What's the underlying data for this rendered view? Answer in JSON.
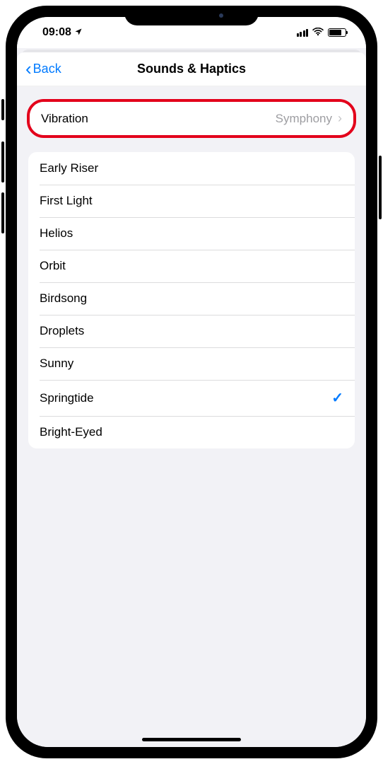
{
  "statusBar": {
    "time": "09:08",
    "locationIcon": "location-arrow"
  },
  "nav": {
    "backLabel": "Back",
    "title": "Sounds & Haptics"
  },
  "vibration": {
    "label": "Vibration",
    "value": "Symphony"
  },
  "highlighted": "vibration",
  "sounds": [
    {
      "label": "Early Riser",
      "selected": false
    },
    {
      "label": "First Light",
      "selected": false
    },
    {
      "label": "Helios",
      "selected": false
    },
    {
      "label": "Orbit",
      "selected": false
    },
    {
      "label": "Birdsong",
      "selected": false
    },
    {
      "label": "Droplets",
      "selected": false
    },
    {
      "label": "Sunny",
      "selected": false
    },
    {
      "label": "Springtide",
      "selected": true
    },
    {
      "label": "Bright-Eyed",
      "selected": false
    }
  ],
  "colors": {
    "tint": "#007aff",
    "highlightRing": "#e3001b",
    "background": "#f2f2f6"
  }
}
